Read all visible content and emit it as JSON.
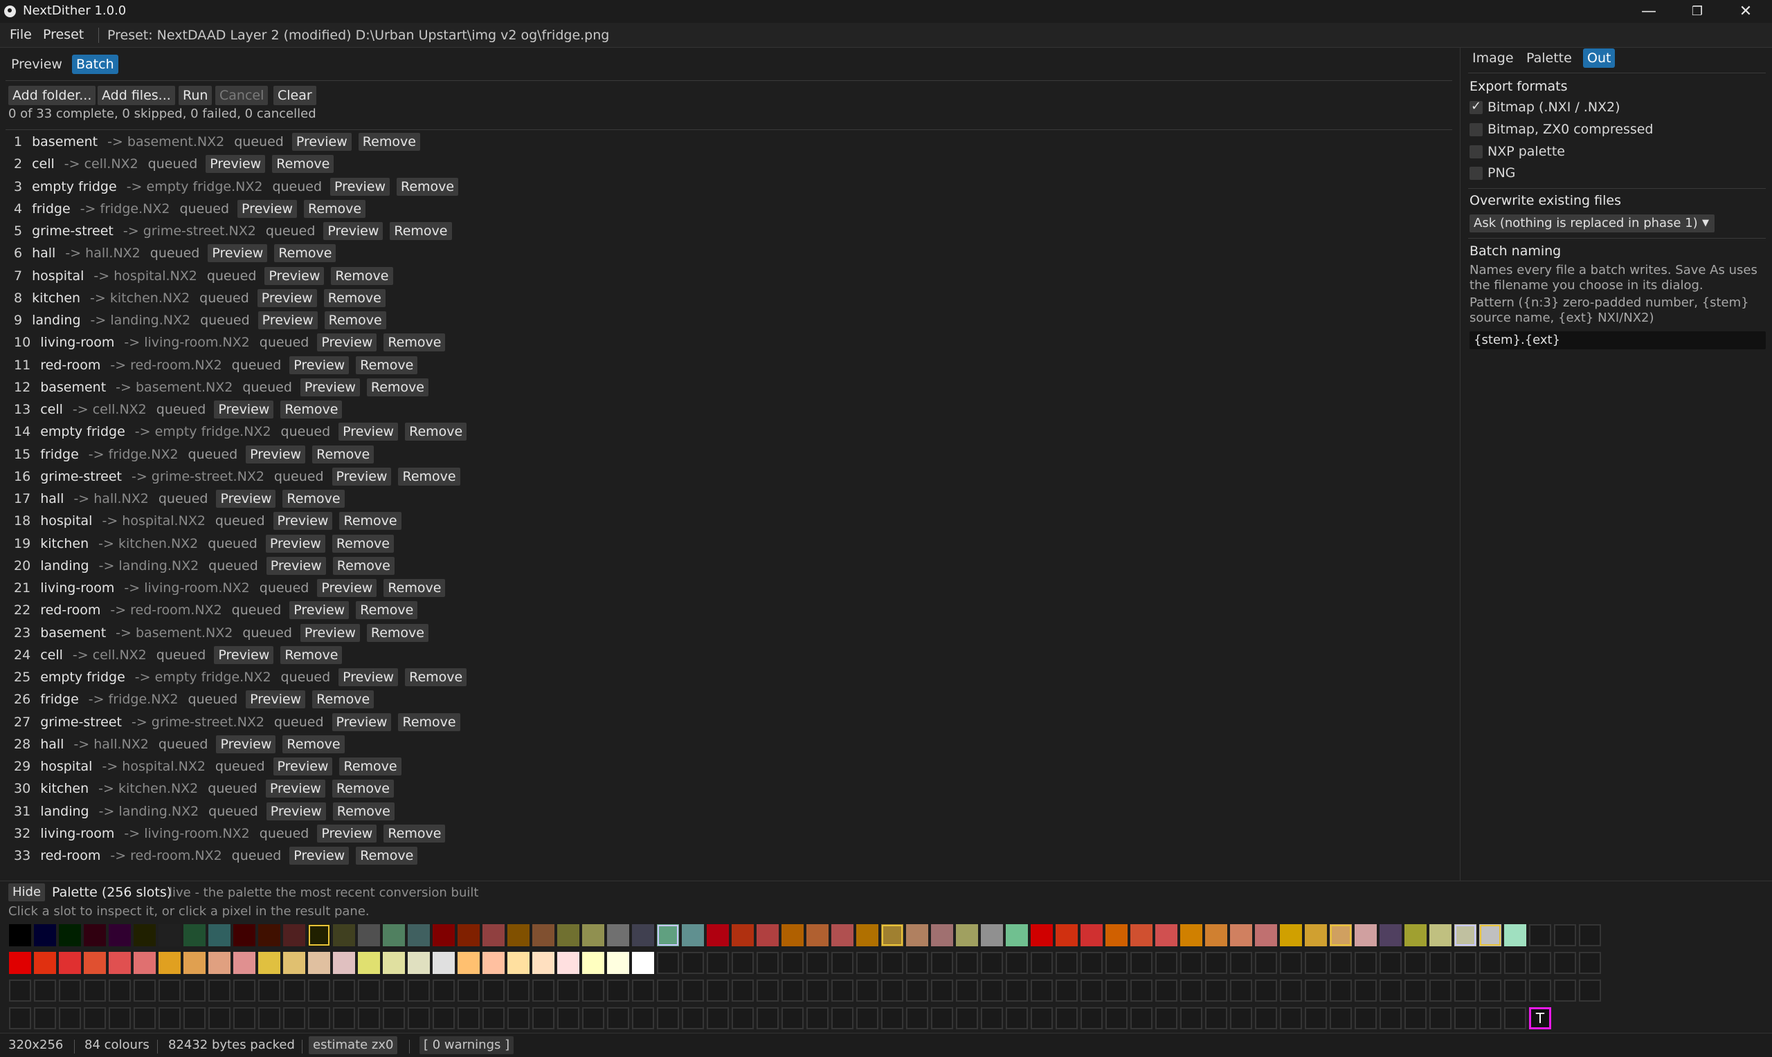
{
  "window": {
    "title": "NextDither 1.0.0",
    "minimize_icon": "—",
    "maximize_icon": "❐",
    "close_icon": "✕"
  },
  "menu": {
    "file": "File",
    "preset": "Preset",
    "status": "Preset: NextDAAD Layer 2 (modified)  D:\\Urban Upstart\\img v2 og\\fridge.png"
  },
  "left_tabs": {
    "preview": "Preview",
    "batch": "Batch"
  },
  "toolbar": {
    "add_folder": "Add folder...",
    "add_files": "Add files...",
    "run": "Run",
    "cancel": "Cancel",
    "clear": "Clear"
  },
  "progress": "0 of 33 complete, 0 skipped, 0 failed, 0 cancelled",
  "row_buttons": {
    "preview": "Preview",
    "remove": "Remove"
  },
  "batch_items": [
    {
      "index": "1",
      "name": "basement",
      "target": "-> basement.NX2",
      "status": "queued"
    },
    {
      "index": "2",
      "name": "cell",
      "target": "-> cell.NX2",
      "status": "queued"
    },
    {
      "index": "3",
      "name": "empty fridge",
      "target": "-> empty fridge.NX2",
      "status": "queued"
    },
    {
      "index": "4",
      "name": "fridge",
      "target": "-> fridge.NX2",
      "status": "queued"
    },
    {
      "index": "5",
      "name": "grime-street",
      "target": "-> grime-street.NX2",
      "status": "queued"
    },
    {
      "index": "6",
      "name": "hall",
      "target": "-> hall.NX2",
      "status": "queued"
    },
    {
      "index": "7",
      "name": "hospital",
      "target": "-> hospital.NX2",
      "status": "queued"
    },
    {
      "index": "8",
      "name": "kitchen",
      "target": "-> kitchen.NX2",
      "status": "queued"
    },
    {
      "index": "9",
      "name": "landing",
      "target": "-> landing.NX2",
      "status": "queued"
    },
    {
      "index": "10",
      "name": "living-room",
      "target": "-> living-room.NX2",
      "status": "queued"
    },
    {
      "index": "11",
      "name": "red-room",
      "target": "-> red-room.NX2",
      "status": "queued"
    },
    {
      "index": "12",
      "name": "basement",
      "target": "-> basement.NX2",
      "status": "queued"
    },
    {
      "index": "13",
      "name": "cell",
      "target": "-> cell.NX2",
      "status": "queued"
    },
    {
      "index": "14",
      "name": "empty fridge",
      "target": "-> empty fridge.NX2",
      "status": "queued"
    },
    {
      "index": "15",
      "name": "fridge",
      "target": "-> fridge.NX2",
      "status": "queued"
    },
    {
      "index": "16",
      "name": "grime-street",
      "target": "-> grime-street.NX2",
      "status": "queued"
    },
    {
      "index": "17",
      "name": "hall",
      "target": "-> hall.NX2",
      "status": "queued"
    },
    {
      "index": "18",
      "name": "hospital",
      "target": "-> hospital.NX2",
      "status": "queued"
    },
    {
      "index": "19",
      "name": "kitchen",
      "target": "-> kitchen.NX2",
      "status": "queued"
    },
    {
      "index": "20",
      "name": "landing",
      "target": "-> landing.NX2",
      "status": "queued"
    },
    {
      "index": "21",
      "name": "living-room",
      "target": "-> living-room.NX2",
      "status": "queued"
    },
    {
      "index": "22",
      "name": "red-room",
      "target": "-> red-room.NX2",
      "status": "queued"
    },
    {
      "index": "23",
      "name": "basement",
      "target": "-> basement.NX2",
      "status": "queued"
    },
    {
      "index": "24",
      "name": "cell",
      "target": "-> cell.NX2",
      "status": "queued"
    },
    {
      "index": "25",
      "name": "empty fridge",
      "target": "-> empty fridge.NX2",
      "status": "queued"
    },
    {
      "index": "26",
      "name": "fridge",
      "target": "-> fridge.NX2",
      "status": "queued"
    },
    {
      "index": "27",
      "name": "grime-street",
      "target": "-> grime-street.NX2",
      "status": "queued"
    },
    {
      "index": "28",
      "name": "hall",
      "target": "-> hall.NX2",
      "status": "queued"
    },
    {
      "index": "29",
      "name": "hospital",
      "target": "-> hospital.NX2",
      "status": "queued"
    },
    {
      "index": "30",
      "name": "kitchen",
      "target": "-> kitchen.NX2",
      "status": "queued"
    },
    {
      "index": "31",
      "name": "landing",
      "target": "-> landing.NX2",
      "status": "queued"
    },
    {
      "index": "32",
      "name": "living-room",
      "target": "-> living-room.NX2",
      "status": "queued"
    },
    {
      "index": "33",
      "name": "red-room",
      "target": "-> red-room.NX2",
      "status": "queued"
    }
  ],
  "right_tabs": {
    "image": "Image",
    "palette": "Palette",
    "out": "Out"
  },
  "export": {
    "heading": "Export formats",
    "bitmap": "Bitmap (.NXI / .NX2)",
    "zx0": "Bitmap, ZX0 compressed",
    "nxp": "NXP palette",
    "png": "PNG",
    "bitmap_checked": true,
    "zx0_checked": false,
    "nxp_checked": false,
    "png_checked": false
  },
  "overwrite": {
    "heading": "Overwrite existing files",
    "selected": "Ask (nothing is replaced in phase 1)"
  },
  "naming": {
    "heading": "Batch naming",
    "description": "Names every file a batch writes. Save As uses the filename you choose in its dialog.",
    "pattern_help": "Pattern ({n:3} zero-padded number, {stem} source name, {ext} NXI/NX2)",
    "pattern": "{stem}.{ext}"
  },
  "palette": {
    "hide": "Hide",
    "title": "Palette (256 slots)",
    "live_note": "live - the palette the most recent conversion built",
    "hint": "Click a slot to inspect it, or click a pixel in the result pane.",
    "transparent_label": "T",
    "row1_colors": [
      "#000000",
      "#000030",
      "#002000",
      "#300010",
      "#300030",
      "#202000",
      "#202020",
      "#205030",
      "#306060",
      "#400000",
      "#401000",
      "#502020",
      "#202000",
      "#404020",
      "#505050",
      "#508060",
      "#406060",
      "#800000",
      "#802000",
      "#904040",
      "#805000",
      "#805030",
      "#707030",
      "#909050",
      "#707070",
      "#404050",
      "#60a080",
      "#609090",
      "#b00010",
      "#b03010",
      "#b04040",
      "#b06000",
      "#b06030",
      "#b05050",
      "#b07000",
      "#a08030",
      "#b08060",
      "#a07070",
      "#a0a060",
      "#909090",
      "#70c090",
      "#d00000",
      "#d03010",
      "#d03030",
      "#d06000",
      "#d05030",
      "#d05050",
      "#d08000",
      "#d08030",
      "#d08060",
      "#c07070",
      "#d0a000",
      "#d0a030",
      "#d0a060",
      "#d0a0a0",
      "#504060",
      "#a0a030",
      "#c0c080",
      "#c0c0a0",
      "#c0c0c0",
      "#a0e0c0"
    ],
    "row1_yellow_outline": [
      12,
      35,
      53,
      59
    ],
    "row1_blue_outline": [
      26,
      58
    ],
    "row2_colors": [
      "#e00000",
      "#e03010",
      "#e03030",
      "#e05030",
      "#e05050",
      "#e07070",
      "#e0a020",
      "#e0a050",
      "#e0a080",
      "#e09090",
      "#e0c040",
      "#e0c070",
      "#e0c0a0",
      "#e0c0c0",
      "#e0e070",
      "#e0e0a0",
      "#e0e0c0",
      "#e0e0e0",
      "#ffc070",
      "#ffc0a0",
      "#ffe0a0",
      "#ffe0c0",
      "#ffe0e0",
      "#ffffc0",
      "#ffffe0",
      "#ffffff"
    ],
    "columns": 64,
    "rows": 4
  },
  "status": {
    "size": "320x256",
    "colours": "84 colours",
    "bytes": "82432 bytes packed",
    "estimate": "estimate zx0",
    "warnings": "[ 0 warnings ]"
  }
}
